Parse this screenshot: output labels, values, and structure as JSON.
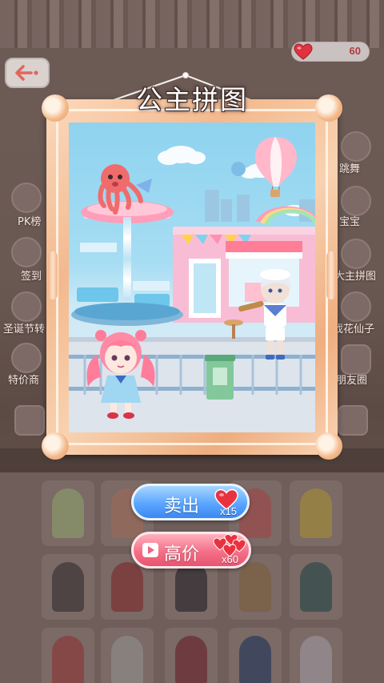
{
  "header": {
    "back_icon": "arrow-left-icon",
    "hearts_icon": "heart-icon",
    "hearts_count": "60"
  },
  "puzzle": {
    "title": "公主拼图"
  },
  "actions": {
    "sell": {
      "label": "卖出",
      "cost": "x15",
      "icon": "heart-icon"
    },
    "premium": {
      "label": "高价",
      "cost": "x60",
      "icon": "video-play-icon",
      "reward_icon": "hearts-pile-icon"
    }
  },
  "background_menu": {
    "left": [
      "PK榜",
      "签到",
      "圣诞节转",
      "特价商"
    ],
    "right": [
      "跳舞",
      "宝宝",
      "大主拼图",
      "戏花仙子",
      "朋友圈"
    ]
  },
  "colors": {
    "sell_button": "#4a94f8",
    "premium_button": "#ef6480",
    "frame": "#f4b98d"
  }
}
